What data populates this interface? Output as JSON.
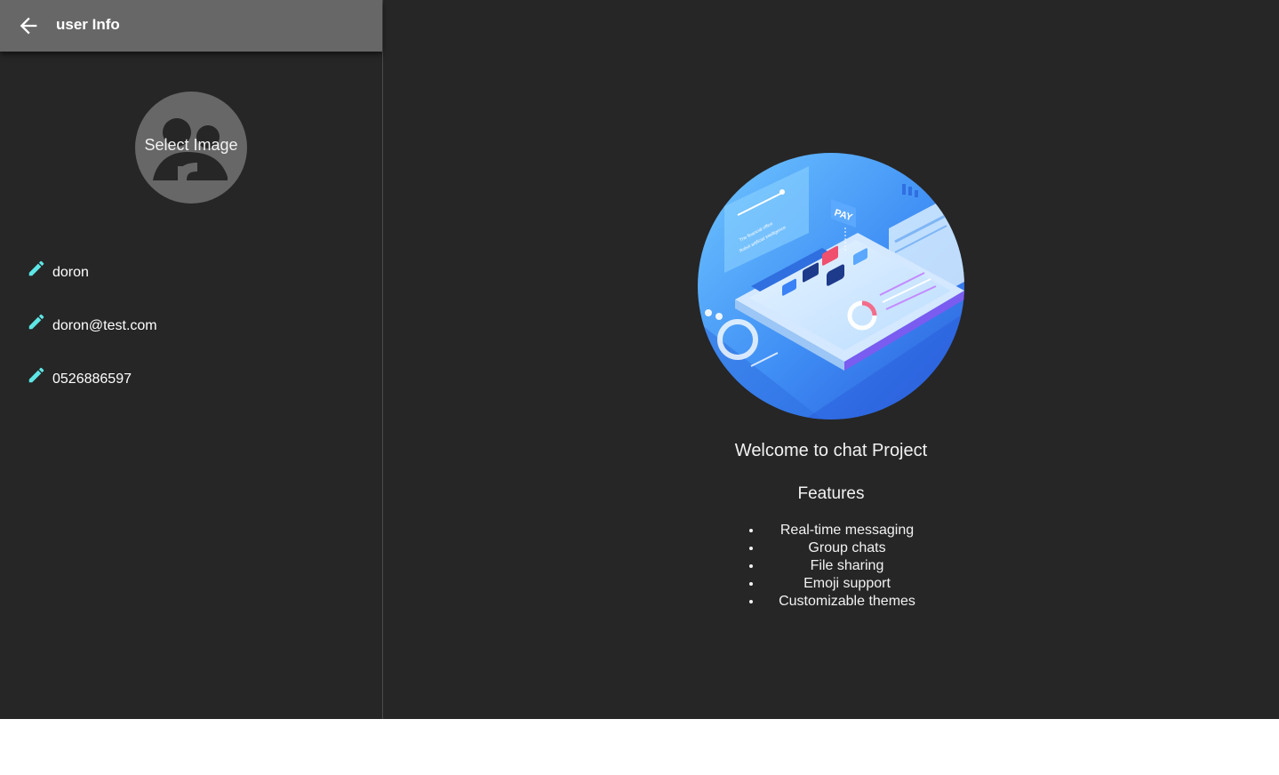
{
  "sidebar": {
    "header": {
      "title": "user Info",
      "back_icon": "arrow-left-icon"
    },
    "avatar": {
      "label": "Select Image",
      "icon": "group-avatar-icon"
    },
    "fields": [
      {
        "icon": "pencil-icon",
        "value": "doron"
      },
      {
        "icon": "pencil-icon",
        "value": "doron@test.com"
      },
      {
        "icon": "pencil-icon",
        "value": "0526886597"
      }
    ]
  },
  "main": {
    "hero_labels": {
      "pay": "PAY",
      "office": "The financial office",
      "robot": "Robot artificial intelligence"
    },
    "welcome": "Welcome to chat Project",
    "features_title": "Features",
    "features": [
      "Real-time messaging",
      "Group chats",
      "File sharing",
      "Emoji support",
      "Customizable themes"
    ]
  },
  "colors": {
    "background": "#262626",
    "header": "#676767",
    "accent": "#5ee6e6",
    "text": "#ffffff"
  }
}
